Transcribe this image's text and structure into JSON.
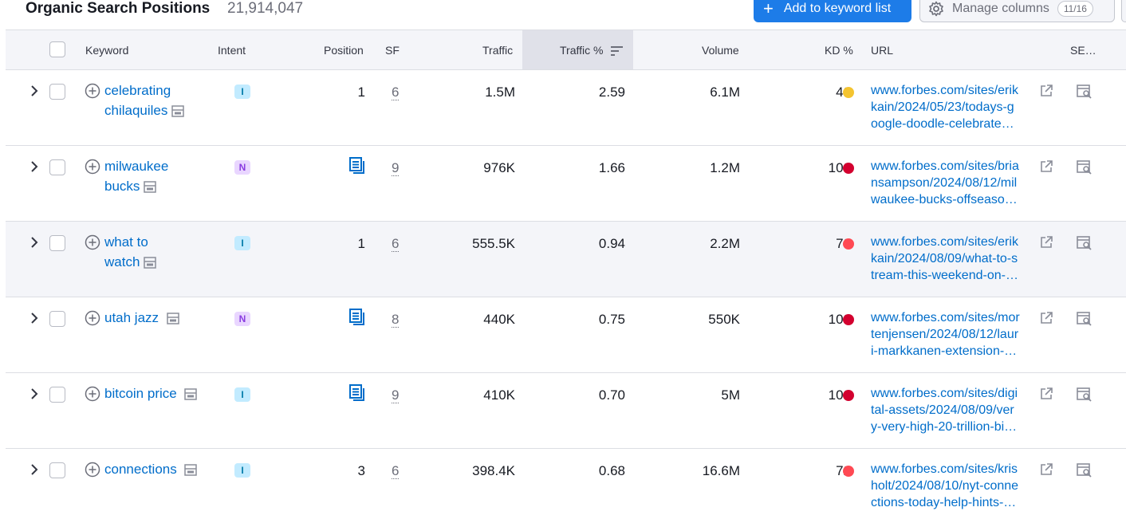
{
  "header": {
    "title": "Organic Search Positions",
    "count": "21,914,047",
    "add_label": "Add to keyword list",
    "manage_label": "Manage columns",
    "manage_badge": "11/16"
  },
  "columns": {
    "keyword": "Keyword",
    "intent": "Intent",
    "position": "Position",
    "sf": "SF",
    "traffic": "Traffic",
    "traffic_pct": "Traffic %",
    "volume": "Volume",
    "kd": "KD %",
    "url": "URL",
    "se": "SE…"
  },
  "colors": {
    "kd_yellow": "#f4c430",
    "kd_red_dark": "#d3002f",
    "kd_red": "#ff4953"
  },
  "rows": [
    {
      "kw1": "celebrating",
      "kw2": "chilaquiles",
      "intent": "I",
      "position": "1",
      "sf": "6",
      "traffic": "1.5M",
      "traffic_pct": "2.59",
      "volume": "6.1M",
      "kd": "40",
      "kd_color": "#f4c430",
      "url1": "www.forbes.com/sites/erik",
      "url2": "kain/2024/05/23/todays-g",
      "url3": "oogle-doodle-celebrate…",
      "has_pos_icon": false
    },
    {
      "kw1": "milwaukee",
      "kw2": "bucks",
      "intent": "N",
      "position": "",
      "sf": "9",
      "traffic": "976K",
      "traffic_pct": "1.66",
      "volume": "1.2M",
      "kd": "100",
      "kd_color": "#d3002f",
      "url1": "www.forbes.com/sites/bria",
      "url2": "nsampson/2024/08/12/mil",
      "url3": "waukee-bucks-offseaso…",
      "has_pos_icon": true
    },
    {
      "kw1": "what to",
      "kw2": "watch",
      "intent": "I",
      "position": "1",
      "sf": "6",
      "traffic": "555.5K",
      "traffic_pct": "0.94",
      "volume": "2.2M",
      "kd": "70",
      "kd_color": "#ff4953",
      "url1": "www.forbes.com/sites/erik",
      "url2": "kain/2024/08/09/what-to-s",
      "url3": "tream-this-weekend-on-…",
      "has_pos_icon": false
    },
    {
      "kw1": "utah jazz",
      "kw2": "",
      "intent": "N",
      "position": "",
      "sf": "8",
      "traffic": "440K",
      "traffic_pct": "0.75",
      "volume": "550K",
      "kd": "100",
      "kd_color": "#d3002f",
      "url1": "www.forbes.com/sites/mor",
      "url2": "tenjensen/2024/08/12/laur",
      "url3": "i-markkanen-extension-…",
      "has_pos_icon": true
    },
    {
      "kw1": "bitcoin price",
      "kw2": "",
      "intent": "I",
      "position": "",
      "sf": "9",
      "traffic": "410K",
      "traffic_pct": "0.70",
      "volume": "5M",
      "kd": "100",
      "kd_color": "#d3002f",
      "url1": "www.forbes.com/sites/digi",
      "url2": "tal-assets/2024/08/09/ver",
      "url3": "y-very-high-20-trillion-bi…",
      "has_pos_icon": true
    },
    {
      "kw1": "connections",
      "kw2": "",
      "intent": "I",
      "position": "3",
      "sf": "6",
      "traffic": "398.4K",
      "traffic_pct": "0.68",
      "volume": "16.6M",
      "kd": "72",
      "kd_color": "#ff4953",
      "url1": "www.forbes.com/sites/kris",
      "url2": "holt/2024/08/10/nyt-conne",
      "url3": "ctions-today-help-hints-…",
      "has_pos_icon": false
    }
  ]
}
